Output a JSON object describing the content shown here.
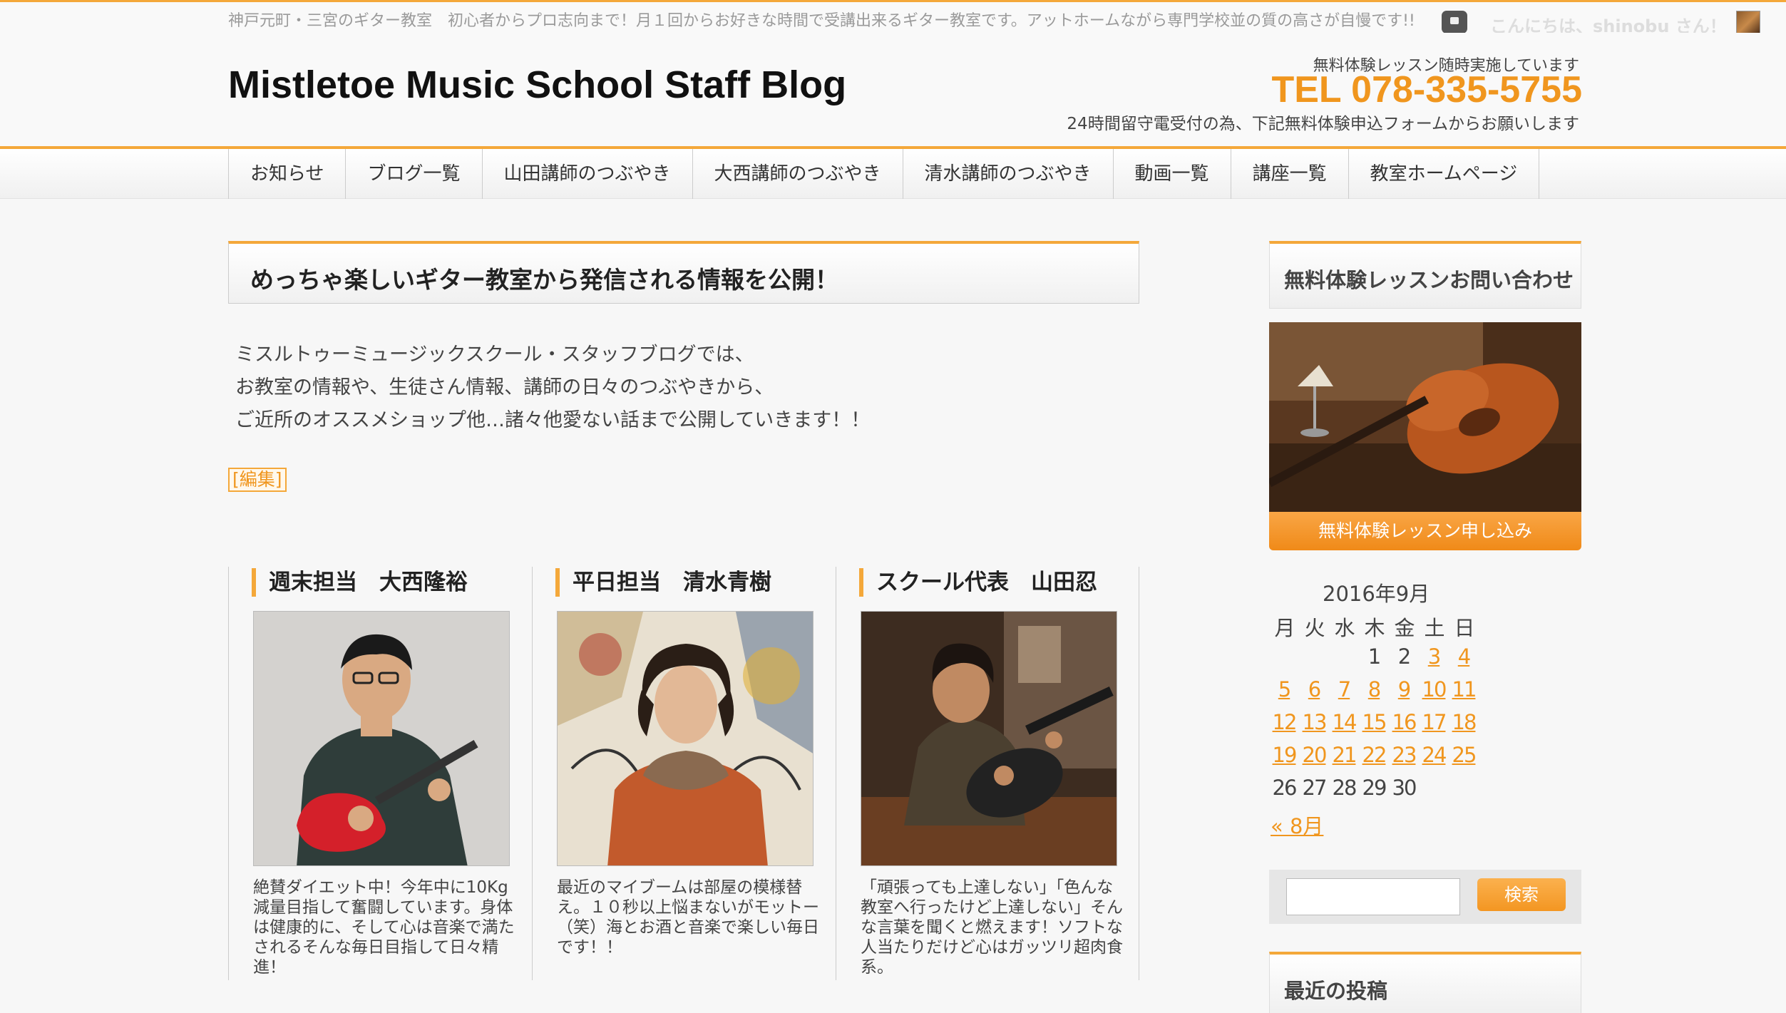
{
  "topbar": {
    "tagline": "神戸元町・三宮のギター教室　初心者からプロ志向まで！月１回からお好きな時間で受講出来るギター教室です。アットホームながら専門学校並の質の高さが自慢です!!",
    "greeting": "こんにちは、shinobu さん！"
  },
  "header": {
    "site_title": "Mistletoe Music School Staff Blog",
    "contact_note": "無料体験レッスン随時実施しています",
    "tel": "TEL 078-335-5755",
    "tel_note": "24時間留守電受付の為、下記無料体験申込フォームからお願いします"
  },
  "nav": {
    "items": [
      "お知らせ",
      "ブログ一覧",
      "山田講師のつぶやき",
      "大西講師のつぶやき",
      "清水講師のつぶやき",
      "動画一覧",
      "講座一覧",
      "教室ホームページ"
    ]
  },
  "main": {
    "lead_title": "めっちゃ楽しいギター教室から発信される情報を公開！",
    "intro": [
      "ミスルトゥーミュージックスクール・スタッフブログでは、",
      "お教室の情報や、生徒さん情報、講師の日々のつぶやきから、",
      "ご近所のオススメショップ他…諸々他愛ない話まで公開していきます！！"
    ],
    "edit_label": "[編集]",
    "staff": [
      {
        "heading": "週末担当　大西隆裕",
        "text": "絶賛ダイエット中！今年中に10Kg減量目指して奮闘しています。身体は健康的に、そして心は音楽で満たされるそんな毎日目指して日々精進！"
      },
      {
        "heading": "平日担当　清水青樹",
        "text": "最近のマイブームは部屋の模様替え。１０秒以上悩まないがモットー（笑）海とお酒と音楽で楽しい毎日です！！"
      },
      {
        "heading": "スクール代表　山田忍",
        "text": "「頑張っても上達しない」「色んな教室へ行ったけど上達しない」そんな言葉を聞くと燃えます！ソフトな人当たりだけど心はガッツリ超肉食系。"
      }
    ]
  },
  "sidebar": {
    "inquiry_title": "無料体験レッスンお問い合わせ",
    "trial_button": "無料体験レッスン申し込み",
    "calendar": {
      "caption": "2016年9月",
      "weekdays": [
        "月",
        "火",
        "水",
        "木",
        "金",
        "土",
        "日"
      ],
      "weeks": [
        [
          "",
          "",
          "",
          "1",
          "2",
          "3",
          "4"
        ],
        [
          "5",
          "6",
          "7",
          "8",
          "9",
          "10",
          "11"
        ],
        [
          "12",
          "13",
          "14",
          "15",
          "16",
          "17",
          "18"
        ],
        [
          "19",
          "20",
          "21",
          "22",
          "23",
          "24",
          "25"
        ],
        [
          "26",
          "27",
          "28",
          "29",
          "30",
          "",
          ""
        ]
      ],
      "linked_days": [
        "3",
        "4",
        "5",
        "6",
        "7",
        "8",
        "9",
        "10",
        "11",
        "12",
        "13",
        "14",
        "15",
        "16",
        "17",
        "18",
        "19",
        "20",
        "21",
        "22",
        "23",
        "24",
        "25"
      ],
      "prev_link": "« 8月"
    },
    "search": {
      "button": "検索",
      "value": ""
    },
    "recent_title": "最近の投稿"
  },
  "colors": {
    "accent": "#f4a83a",
    "link": "#f0961e"
  }
}
